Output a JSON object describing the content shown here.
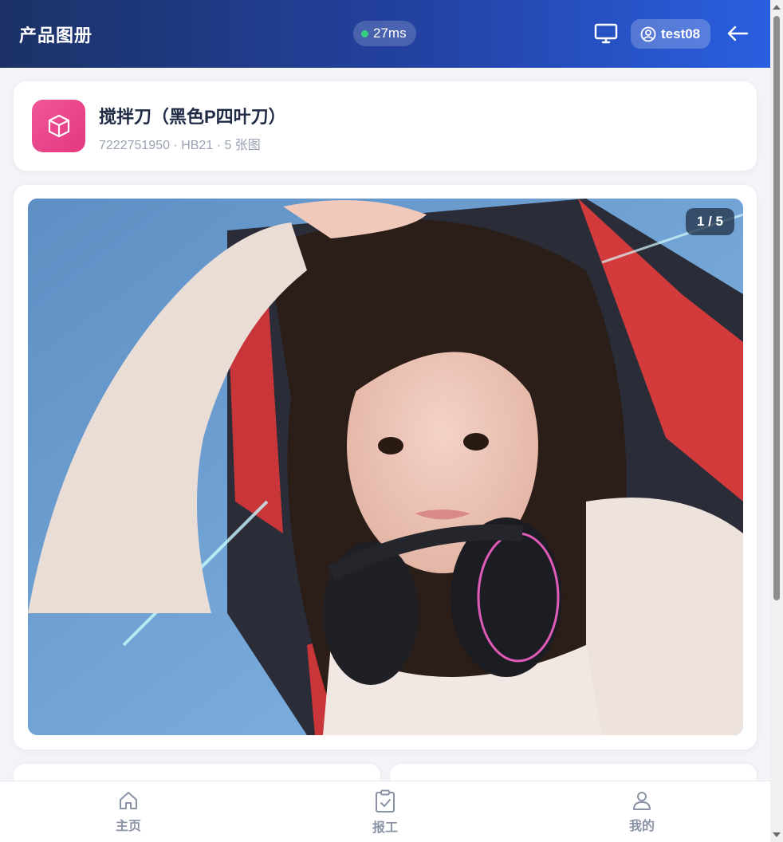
{
  "header": {
    "title": "产品图册",
    "latency": "27ms",
    "username": "test08",
    "icons": {
      "monitor": "monitor-icon",
      "user": "user-circle-icon",
      "back": "arrow-left-icon"
    },
    "status_color": "#35d07f"
  },
  "product": {
    "name": "搅拌刀（黑色P四叶刀）",
    "meta": "7222751950 · HB21 · 5 张图",
    "icon": "cube-icon",
    "icon_color": "#e8438a"
  },
  "gallery": {
    "counter": "1 / 5",
    "current_index": 1,
    "total": 5
  },
  "bottom_nav": {
    "items": [
      {
        "label": "主页",
        "icon": "home-icon"
      },
      {
        "label": "报工",
        "icon": "clipboard-check-icon"
      },
      {
        "label": "我的",
        "icon": "user-icon"
      }
    ]
  }
}
